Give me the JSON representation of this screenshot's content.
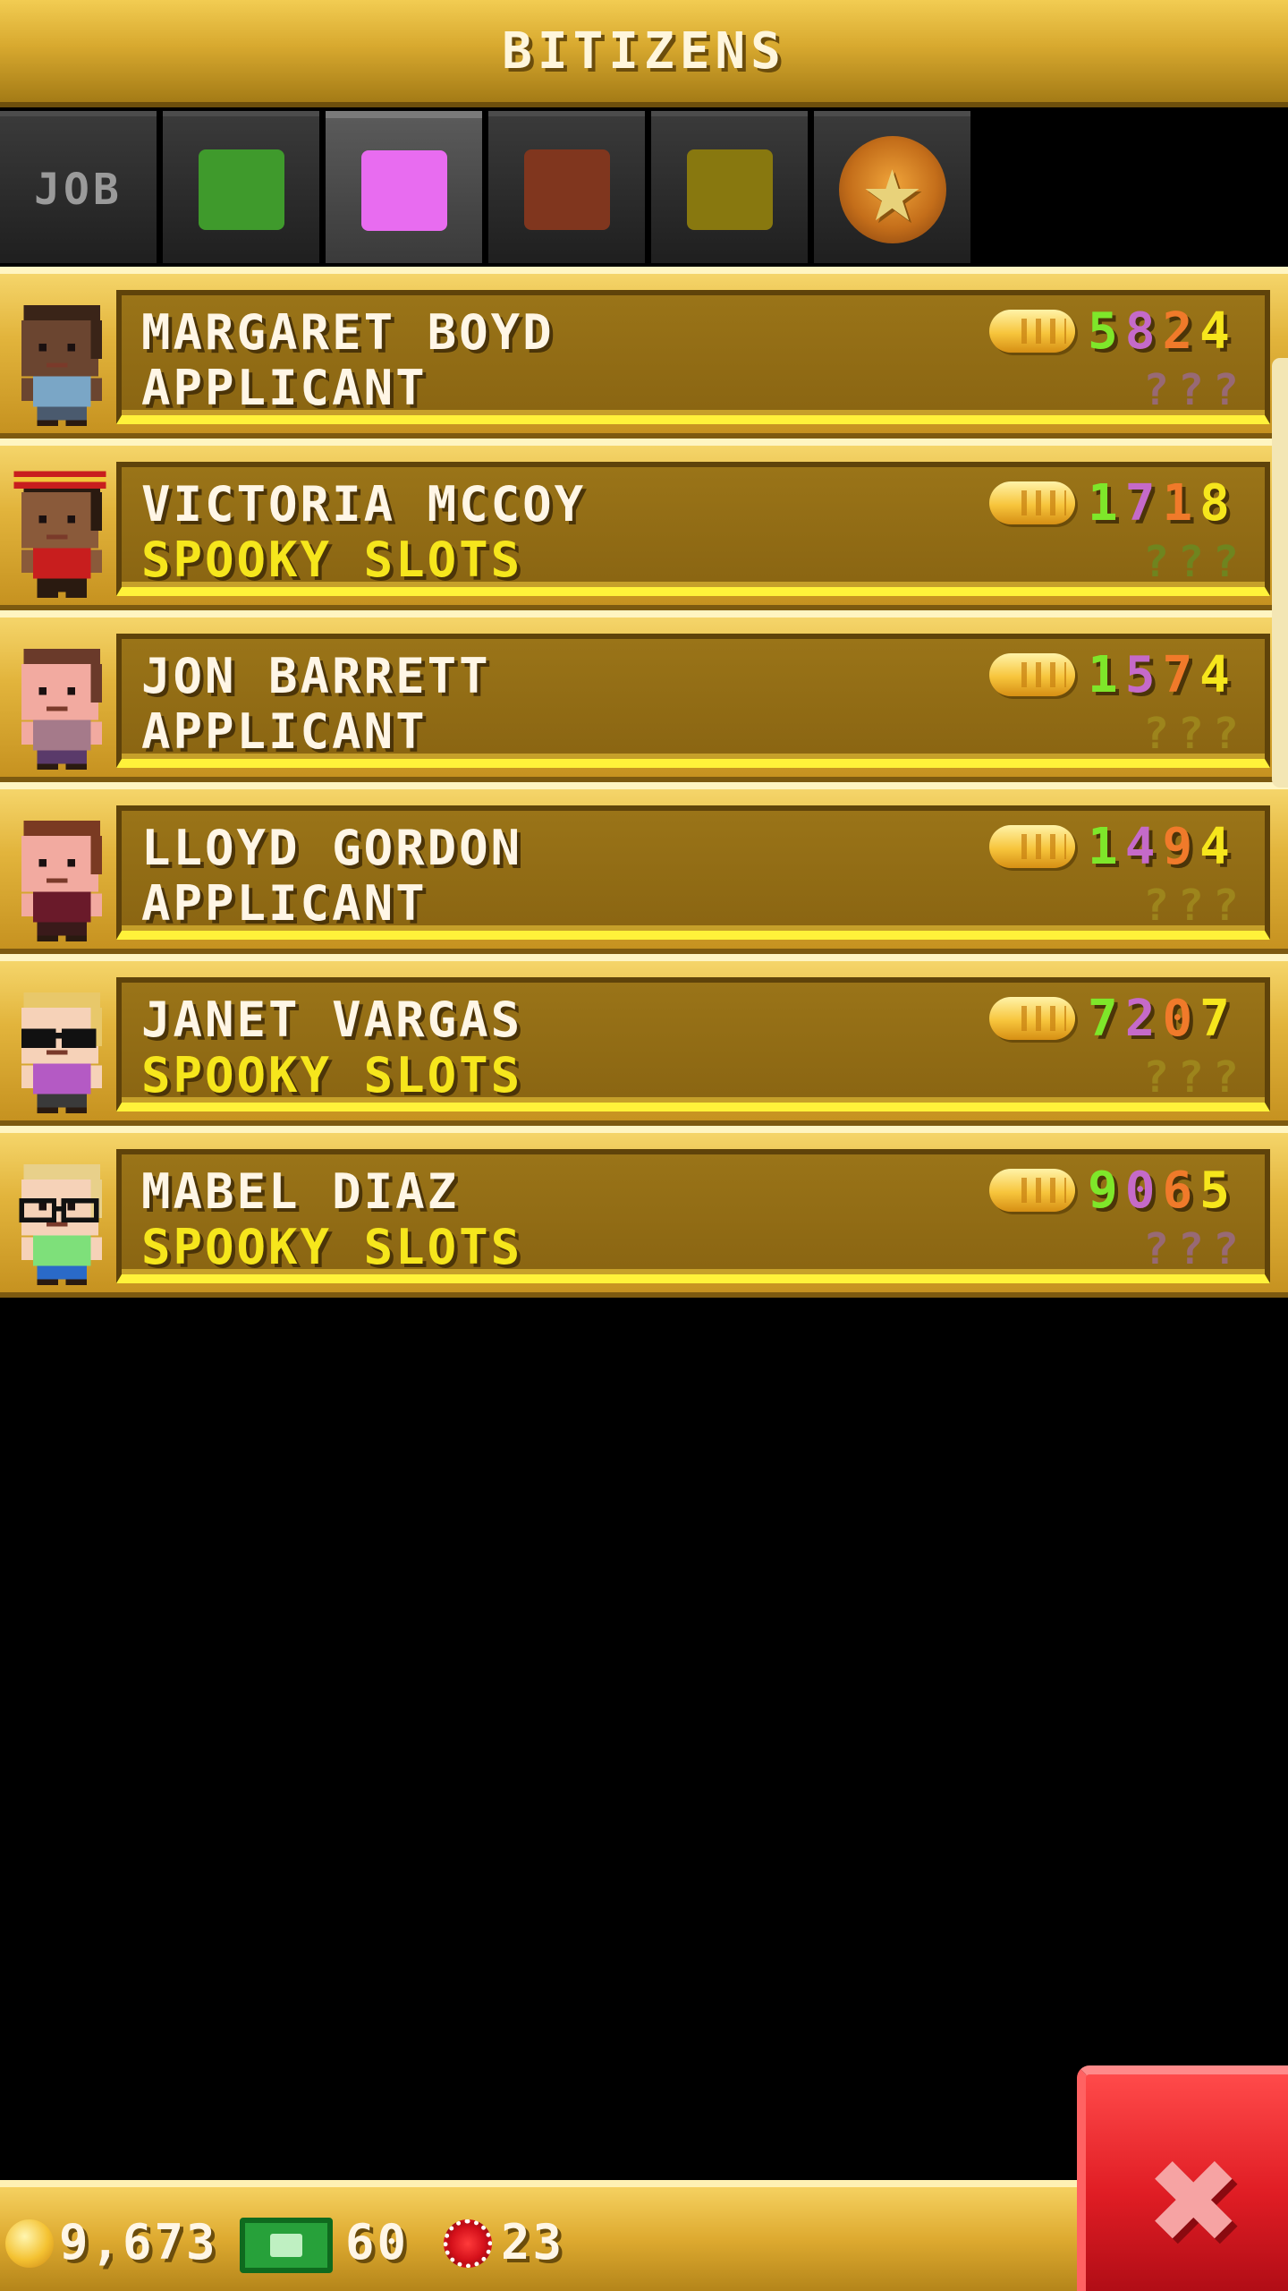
{
  "header": {
    "title": "BITIZENS"
  },
  "tabs": [
    {
      "label": "JOB",
      "kind": "text",
      "selected": false
    },
    {
      "kind": "swatch",
      "color": "#3f9a2c",
      "selected": false
    },
    {
      "kind": "swatch",
      "color": "#e86cf0",
      "selected": true
    },
    {
      "kind": "swatch",
      "color": "#80361e",
      "selected": false
    },
    {
      "kind": "swatch",
      "color": "#88780f",
      "selected": false
    },
    {
      "kind": "star-badge",
      "icon": "star-badge-icon",
      "selected": false
    }
  ],
  "bitizens": [
    {
      "name": "MARGARET BOYD",
      "job": "APPLICANT",
      "job_color": "#fff6e6",
      "digits": [
        "5",
        "8",
        "2",
        "4"
      ],
      "digit_colors": [
        "#7ee72a",
        "#c56ac9",
        "#f07a2a",
        "#f6e61c"
      ],
      "q_color": "#9a6a86",
      "avatar": {
        "skin": "#6b4530",
        "hair": "#3a2418",
        "shirt": "#7aa6c6",
        "pants": "#4a5a6e",
        "accessory": "none"
      }
    },
    {
      "name": "VICTORIA MCCOY",
      "job": "SPOOKY SLOTS",
      "job_color": "#f6e61c",
      "digits": [
        "1",
        "7",
        "1",
        "8"
      ],
      "digit_colors": [
        "#7ee72a",
        "#c56ac9",
        "#f07a2a",
        "#f6e61c"
      ],
      "q_color": "#6a8a22",
      "avatar": {
        "skin": "#8a5a3a",
        "hair": "#2a1a10",
        "shirt": "#c81e1e",
        "pants": "#2a1a10",
        "accessory": "cap"
      }
    },
    {
      "name": "JON BARRETT",
      "job": "APPLICANT",
      "job_color": "#fff6e6",
      "digits": [
        "1",
        "5",
        "7",
        "4"
      ],
      "digit_colors": [
        "#7ee72a",
        "#c56ac9",
        "#f07a2a",
        "#f6e61c"
      ],
      "q_color": "#a08a1e",
      "avatar": {
        "skin": "#f2aaa0",
        "hair": "#6a3a2a",
        "shirt": "#a57a8a",
        "pants": "#5a3a6a",
        "accessory": "none"
      }
    },
    {
      "name": "LLOYD GORDON",
      "job": "APPLICANT",
      "job_color": "#fff6e6",
      "digits": [
        "1",
        "4",
        "9",
        "4"
      ],
      "digit_colors": [
        "#7ee72a",
        "#c56ac9",
        "#f07a2a",
        "#f6e61c"
      ],
      "q_color": "#a08a1e",
      "avatar": {
        "skin": "#f2aaa0",
        "hair": "#7a3a22",
        "shirt": "#6a1a2a",
        "pants": "#3a1a1a",
        "accessory": "none"
      }
    },
    {
      "name": "JANET VARGAS",
      "job": "SPOOKY SLOTS",
      "job_color": "#f6e61c",
      "digits": [
        "7",
        "2",
        "0",
        "7"
      ],
      "digit_colors": [
        "#7ee72a",
        "#c56ac9",
        "#f07a2a",
        "#f6e61c"
      ],
      "q_color": "#a08a1e",
      "avatar": {
        "skin": "#f6d2b8",
        "hair": "#e8c86a",
        "shirt": "#b45ac4",
        "pants": "#3a3a3a",
        "accessory": "shades"
      }
    },
    {
      "name": "MABEL DIAZ",
      "job": "SPOOKY SLOTS",
      "job_color": "#f6e61c",
      "digits": [
        "9",
        "0",
        "6",
        "5"
      ],
      "digit_colors": [
        "#7ee72a",
        "#c56ac9",
        "#f07a2a",
        "#f6e61c"
      ],
      "q_color": "#9a6a86",
      "avatar": {
        "skin": "#f6d2b8",
        "hair": "#e8d08a",
        "shirt": "#7ee07a",
        "pants": "#2a6ac8",
        "accessory": "glasses"
      }
    }
  ],
  "footer": {
    "coins": "9,673",
    "bux": "60",
    "chips": "23",
    "coin_icon": "coin-icon",
    "bux_icon": "bux-icon",
    "chip_icon": "casino-chip-icon"
  },
  "close_button": {
    "glyph": "✖",
    "icon": "close-icon"
  }
}
